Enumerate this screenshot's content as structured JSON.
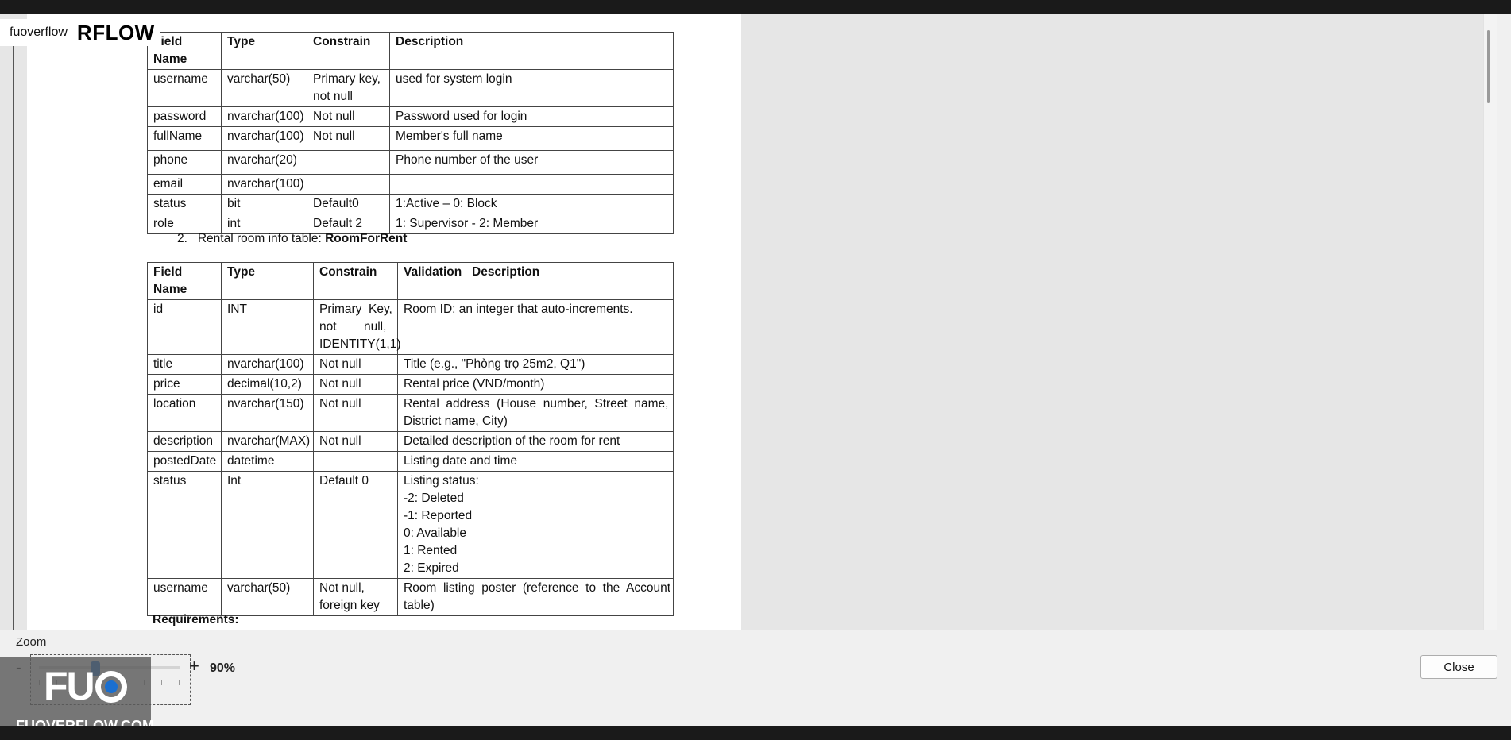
{
  "brand": {
    "small_text": "fuoverflow",
    "big_text": "RFLOW"
  },
  "account_table": {
    "headers": [
      "Field Name",
      "Type",
      "Constrain",
      "Description"
    ],
    "rows": [
      {
        "field": "username",
        "type": "varchar(50)",
        "constrain_a": "Primary key,",
        "constrain_b": "not null",
        "description": "used for system login"
      },
      {
        "field": "password",
        "type": "nvarchar(100)",
        "constrain_a": "Not null",
        "description": "Password used for login"
      },
      {
        "field": "fullName",
        "type": "nvarchar(100)",
        "constrain_a": "Not null",
        "description": "Member's full name"
      },
      {
        "field": "phone",
        "type": "nvarchar(20)",
        "constrain_a": "",
        "description": "Phone number of the user"
      },
      {
        "field": "email",
        "type": "nvarchar(100)",
        "constrain_a": "",
        "description": ""
      },
      {
        "field": "status",
        "type": "bit",
        "constrain_a": "Default0",
        "description": "1:Active – 0: Block"
      },
      {
        "field": "role",
        "type": "int",
        "constrain_a": "Default 2",
        "description": "1: Supervisor - 2: Member"
      }
    ]
  },
  "section2": {
    "prefix": "2.   Rental room info table: ",
    "table_name": "RoomForRent"
  },
  "room_table": {
    "headers": [
      "Field Name",
      "Type",
      "Constrain",
      "Validation",
      "Description"
    ],
    "rows": [
      {
        "field": "id",
        "type": "INT",
        "constrain_lines": [
          "Primary  Key,",
          "not        null,",
          "IDENTITY(1,1)"
        ],
        "description_lines": [
          "Room ID: an integer that auto-increments."
        ]
      },
      {
        "field": "title",
        "type": "nvarchar(100)",
        "constrain_lines": [
          "Not null"
        ],
        "description_lines": [
          "Title (e.g., \"Phòng trọ 25m2, Q1\")"
        ]
      },
      {
        "field": "price",
        "type": "decimal(10,2)",
        "constrain_lines": [
          "Not null"
        ],
        "description_lines": [
          "Rental price (VND/month)"
        ]
      },
      {
        "field": "location",
        "type": "nvarchar(150)",
        "constrain_lines": [
          "Not null"
        ],
        "description_lines": [
          "Rental  address  (House  number,  Street  name,",
          "District name, City)"
        ]
      },
      {
        "field": "description",
        "type": "nvarchar(MAX)",
        "constrain_lines": [
          "Not null"
        ],
        "description_lines": [
          "Detailed description of the room for rent"
        ]
      },
      {
        "field": "postedDate",
        "type": "datetime",
        "constrain_lines": [],
        "description_lines": [
          "Listing date and time"
        ]
      },
      {
        "field": "status",
        "type": "Int",
        "constrain_lines": [
          "Default 0"
        ],
        "description_lines": [
          "Listing status:",
          "-2: Deleted",
          "-1: Reported",
          "0: Available",
          "1: Rented",
          "2: Expired"
        ]
      },
      {
        "field": "username",
        "type": "varchar(50)",
        "constrain_lines": [
          "Not null,",
          "foreign key"
        ],
        "description_lines": [
          "Room  listing  poster  (reference  to  the  Account",
          "table)"
        ]
      }
    ]
  },
  "requirements_label": "Requirements:",
  "zoom": {
    "label": "Zoom",
    "minus": "-",
    "plus": "+",
    "value_text": "90%",
    "level_percent": 90
  },
  "watermark": {
    "url": "FUOVERFLOW.COM",
    "mark": "FU"
  },
  "close_label": "Close"
}
